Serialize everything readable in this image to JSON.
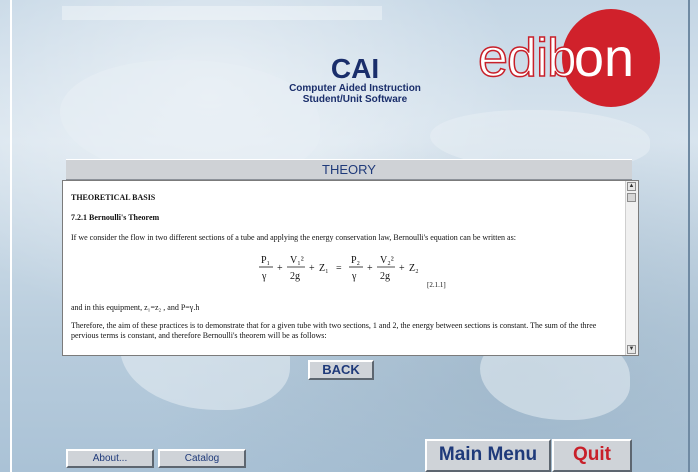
{
  "header": {
    "title": "CAI",
    "subtitle_line1": "Computer Aided Instruction",
    "subtitle_line2": "Student/Unit Software",
    "logo_text_left": "edib",
    "logo_text_right": "on"
  },
  "section": {
    "title": "THEORY"
  },
  "content": {
    "heading": "THEORETICAL BASIS",
    "subheading": "7.2.1 Bernoulli's Theorem",
    "paragraph1": "If we consider the flow in two different sections of a tube and applying the energy conservation law, Bernoulli's equation can be written as:",
    "equation_ref": "[2.1.1]",
    "paragraph2": "and in this equipment, z₁=z₂ , and P=γ.h",
    "paragraph3": "Therefore, the aim of these practices is to demonstrate that for a given tube with two sections, 1 and 2, the energy between sections is constant. The sum of the three pervious terms is constant, and therefore Bernoulli's theorem will be as follows:",
    "equation": {
      "p1": "P₁",
      "v1": "V₁²",
      "z1": "Z₁",
      "p2": "P₂",
      "v2": "V₂²",
      "z2": "Z₂",
      "gamma": "γ",
      "two_g": "2g"
    }
  },
  "buttons": {
    "back": "BACK",
    "about": "About...",
    "catalog": "Catalog",
    "main_menu": "Main Menu",
    "quit": "Quit"
  },
  "colors": {
    "brand_red": "#c8202a",
    "title_blue": "#1a2e6b"
  }
}
